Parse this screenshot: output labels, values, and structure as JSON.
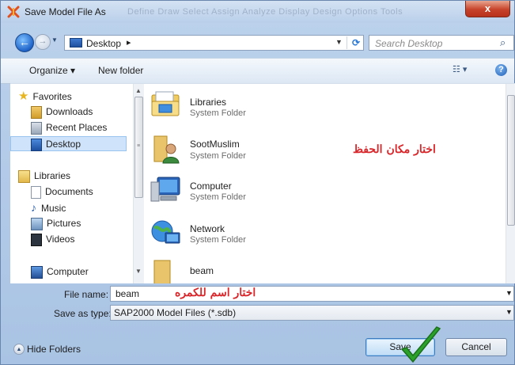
{
  "window": {
    "title": "Save Model File As",
    "close_glyph": "x",
    "background_menu": "Define  Draw  Select  Assign  Analyze  Display  Design  Options  Tools"
  },
  "nav": {
    "back_glyph": "←",
    "forward_glyph": "→",
    "address": "Desktop",
    "search_placeholder": "Search Desktop"
  },
  "toolbar": {
    "organize": "Organize ▾",
    "new_folder": "New folder",
    "view_glyph": "☷ ▾",
    "help_glyph": "?"
  },
  "sidebar": {
    "items": [
      {
        "label": "Favorites",
        "icon": "star-icon"
      },
      {
        "label": "Downloads",
        "icon": "downloads-icon"
      },
      {
        "label": "Recent Places",
        "icon": "recent-places-icon"
      },
      {
        "label": "Desktop",
        "icon": "desktop-icon",
        "selected": true
      },
      {
        "label": "Libraries",
        "icon": "libraries-icon"
      },
      {
        "label": "Documents",
        "icon": "documents-icon"
      },
      {
        "label": "Music",
        "icon": "music-icon"
      },
      {
        "label": "Pictures",
        "icon": "pictures-icon"
      },
      {
        "label": "Videos",
        "icon": "videos-icon"
      },
      {
        "label": "Computer",
        "icon": "computer-icon"
      }
    ]
  },
  "files": [
    {
      "name": "Libraries",
      "type": "System Folder",
      "icon": "libraries-folder-icon"
    },
    {
      "name": "SootMuslim",
      "type": "System Folder",
      "icon": "user-folder-icon"
    },
    {
      "name": "Computer",
      "type": "System Folder",
      "icon": "computer-icon"
    },
    {
      "name": "Network",
      "type": "System Folder",
      "icon": "network-icon"
    },
    {
      "name": "beam",
      "type": "",
      "icon": "folder-icon"
    }
  ],
  "annotations": {
    "choose_location": "اختار مكان الحفظ",
    "choose_name": "اختار اسم للكمره"
  },
  "form": {
    "file_name_label": "File name:",
    "file_name_value": "beam",
    "save_type_label": "Save as type:",
    "save_type_value": "SAP2000 Model Files (*.sdb)"
  },
  "footer": {
    "hide_folders": "Hide Folders",
    "save": "Save",
    "cancel": "Cancel"
  },
  "colors": {
    "annotation": "#d8262a",
    "checkmark": "#2aa12a"
  }
}
